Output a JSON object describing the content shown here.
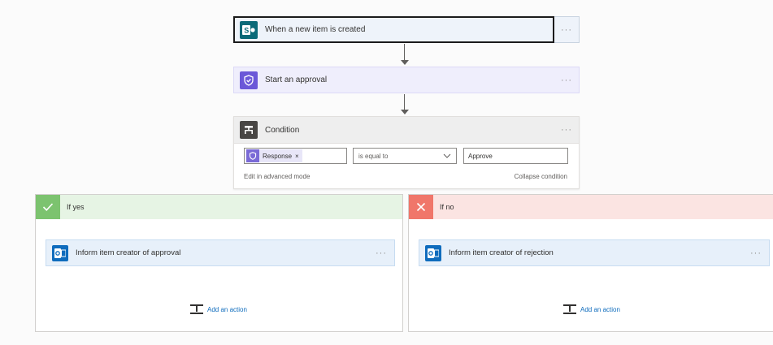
{
  "trigger": {
    "title": "When a new item is created",
    "more": "···"
  },
  "approval": {
    "title": "Start an approval",
    "more": "···"
  },
  "condition": {
    "title": "Condition",
    "more": "···",
    "left_token": "Response",
    "token_remove": "×",
    "operator": "is equal to",
    "right_value": "Approve",
    "edit_advanced": "Edit in advanced mode",
    "collapse": "Collapse condition"
  },
  "branch_yes": {
    "title": "If yes",
    "action_title": "Inform item creator of approval",
    "more": "···",
    "add_action": "Add an action"
  },
  "branch_no": {
    "title": "If no",
    "action_title": "Inform item creator of rejection",
    "more": "···",
    "add_action": "Add an action"
  },
  "icons": {
    "trigger": "sharepoint-icon",
    "approval": "approval-icon",
    "condition": "condition-icon",
    "yes": "check-icon",
    "no": "close-icon",
    "action": "outlook-icon",
    "add": "add-action-icon"
  },
  "colors": {
    "sharepoint": "#0b6a78",
    "approval": "#6b58d8",
    "condition": "#484644",
    "yes_header": "#e6f4e4",
    "yes_icon": "#7cc36f",
    "no_header": "#fbe4e2",
    "no_icon": "#f0766a",
    "outlook": "#0f6cbd"
  }
}
